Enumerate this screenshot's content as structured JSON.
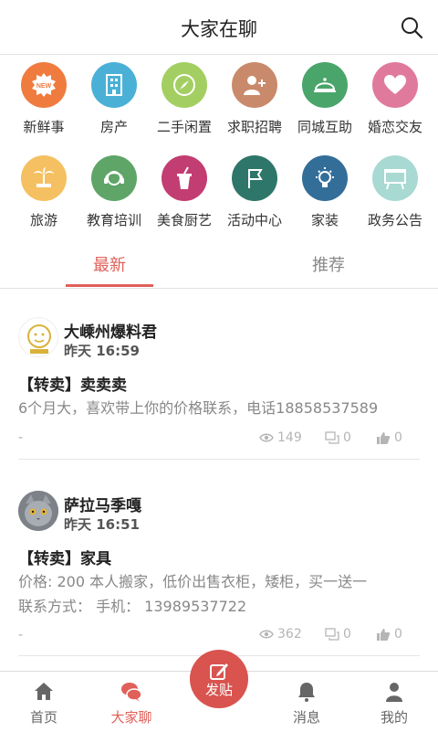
{
  "header": {
    "title": "大家在聊",
    "search_icon": "search-icon"
  },
  "categories": [
    {
      "label": "新鲜事",
      "icon": "new-badge-icon",
      "color": "#f07b3f",
      "badge": "NEW"
    },
    {
      "label": "房产",
      "icon": "building-icon",
      "color": "#4bb0d6"
    },
    {
      "label": "二手闲置",
      "icon": "compass-icon",
      "color": "#a3cf62"
    },
    {
      "label": "求职招聘",
      "icon": "add-user-icon",
      "color": "#c98a6b"
    },
    {
      "label": "同城互助",
      "icon": "service-bell-icon",
      "color": "#4aa56a"
    },
    {
      "label": "婚恋交友",
      "icon": "heart-icon",
      "color": "#e07a9c"
    },
    {
      "label": "旅游",
      "icon": "palm-tree-icon",
      "color": "#f5c062"
    },
    {
      "label": "教育培训",
      "icon": "headset-icon",
      "color": "#5ea567"
    },
    {
      "label": "美食厨艺",
      "icon": "drink-cup-icon",
      "color": "#c23d72"
    },
    {
      "label": "活动中心",
      "icon": "flag-icon",
      "color": "#2e7669"
    },
    {
      "label": "家装",
      "icon": "lightbulb-icon",
      "color": "#336e99"
    },
    {
      "label": "政务公告",
      "icon": "easel-board-icon",
      "color": "#a8d9d3"
    }
  ],
  "tabs": [
    {
      "label": "最新",
      "active": true
    },
    {
      "label": "推荐",
      "active": false
    }
  ],
  "posts": [
    {
      "author": "大嵊州爆料君",
      "time": "昨天 16:59",
      "title": "【转卖】卖卖卖",
      "body": "6个月大，喜欢带上你的价格联系，电话18858537589",
      "dash": "-",
      "views": "149",
      "comments": "0",
      "likes": "0"
    },
    {
      "author": "萨拉马季嘎",
      "time": "昨天 16:51",
      "title": "【转卖】家具",
      "body": "价格: 200 本人搬家，低价出售衣柜，矮柜，买一送一",
      "body2": "联系方式： 手机： 13989537722",
      "dash": "-",
      "views": "362",
      "comments": "0",
      "likes": "0"
    }
  ],
  "tabbar": {
    "home": "首页",
    "chat": "大家聊",
    "post": "发贴",
    "messages": "消息",
    "mine": "我的"
  },
  "colors": {
    "accent": "#e0605a",
    "post_button": "#d9534f"
  }
}
